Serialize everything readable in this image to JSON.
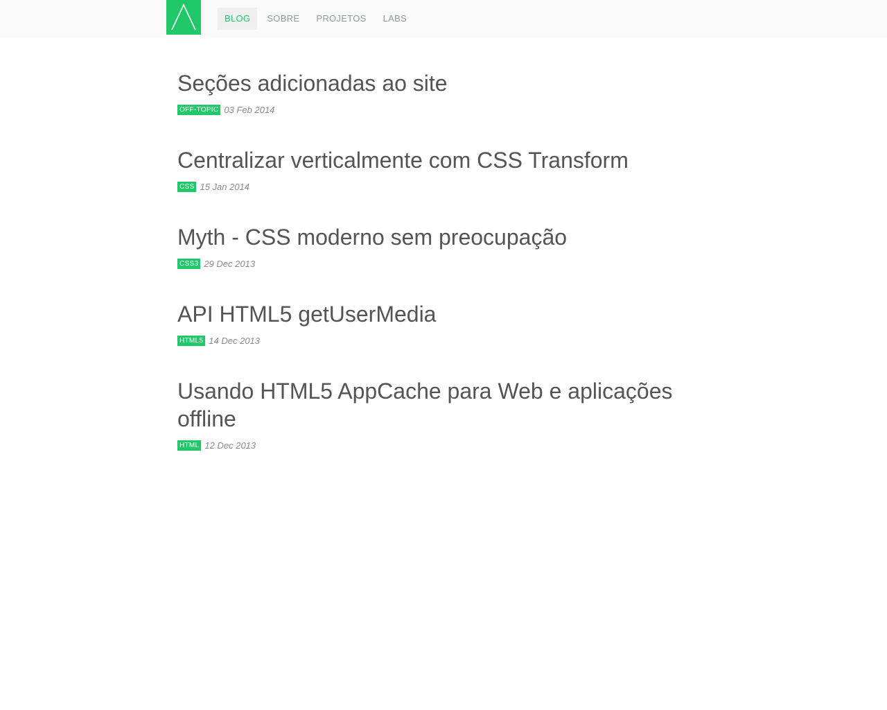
{
  "brand": {
    "logo_icon": "triangle-logo-icon",
    "color": "#21c86a"
  },
  "nav": {
    "items": [
      {
        "label": "BLOG",
        "active": true
      },
      {
        "label": "SOBRE",
        "active": false
      },
      {
        "label": "PROJETOS",
        "active": false
      },
      {
        "label": "LABS",
        "active": false
      }
    ]
  },
  "posts": [
    {
      "title": "Seções adicionadas ao site",
      "tag": "OFF-TOPIC",
      "date": "03 Feb 2014"
    },
    {
      "title": "Centralizar verticalmente com CSS Transform",
      "tag": "CSS",
      "date": "15 Jan 2014"
    },
    {
      "title": "Myth - CSS moderno sem preocupação",
      "tag": "CSS3",
      "date": "29 Dec 2013"
    },
    {
      "title": "API HTML5 getUserMedia",
      "tag": "HTML5",
      "date": "14 Dec 2013"
    },
    {
      "title": "Usando HTML5 AppCache para Web e aplicações offline",
      "tag": "HTML",
      "date": "12 Dec 2013"
    }
  ]
}
